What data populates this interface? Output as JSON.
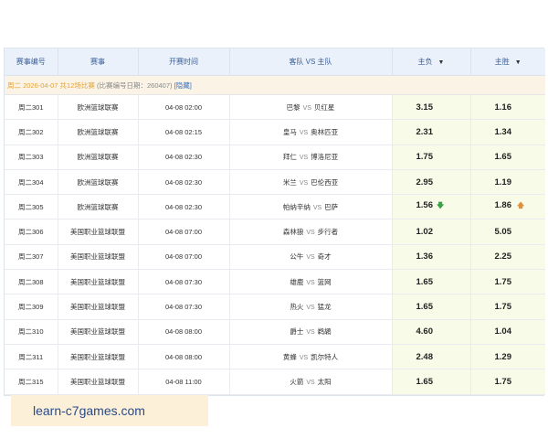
{
  "columns": {
    "match_no": "赛事编号",
    "league": "赛事",
    "start_time": "开赛时间",
    "teams": "客队 VS 主队",
    "away_win": "主负",
    "home_win": "主胜"
  },
  "group": {
    "date": "周二 2026-04-07",
    "count": "共12场比赛",
    "note": "(比赛编号日期：260407)",
    "link": "[隐藏]"
  },
  "vs_label": "VS",
  "rows": [
    {
      "no": "周二301",
      "league": "欧洲篮球联赛",
      "time": "04-08 02:00",
      "away": "巴黎",
      "home": "贝红星",
      "odd1": "3.15",
      "odd2": "1.16"
    },
    {
      "no": "周二302",
      "league": "欧洲篮球联赛",
      "time": "04-08 02:15",
      "away": "皇马",
      "home": "奥林匹亚",
      "odd1": "2.31",
      "odd2": "1.34"
    },
    {
      "no": "周二303",
      "league": "欧洲篮球联赛",
      "time": "04-08 02:30",
      "away": "拜仁",
      "home": "博洛尼亚",
      "odd1": "1.75",
      "odd2": "1.65"
    },
    {
      "no": "周二304",
      "league": "欧洲篮球联赛",
      "time": "04-08 02:30",
      "away": "米兰",
      "home": "巴伦西亚",
      "odd1": "2.95",
      "odd2": "1.19"
    },
    {
      "no": "周二305",
      "league": "欧洲篮球联赛",
      "time": "04-08 02:30",
      "away": "帕纳辛纳",
      "home": "巴萨",
      "odd1": "1.56",
      "odd2": "1.86",
      "odd1_trend": "down",
      "odd2_trend": "up"
    },
    {
      "no": "周二306",
      "league": "美国职业篮球联盟",
      "time": "04-08 07:00",
      "away": "森林狼",
      "home": "步行者",
      "odd1": "1.02",
      "odd2": "5.05"
    },
    {
      "no": "周二307",
      "league": "美国职业篮球联盟",
      "time": "04-08 07:00",
      "away": "公牛",
      "home": "奇才",
      "odd1": "1.36",
      "odd2": "2.25"
    },
    {
      "no": "周二308",
      "league": "美国职业篮球联盟",
      "time": "04-08 07:30",
      "away": "雄鹿",
      "home": "篮网",
      "odd1": "1.65",
      "odd2": "1.75"
    },
    {
      "no": "周二309",
      "league": "美国职业篮球联盟",
      "time": "04-08 07:30",
      "away": "热火",
      "home": "猛龙",
      "odd1": "1.65",
      "odd2": "1.75"
    },
    {
      "no": "周二310",
      "league": "美国职业篮球联盟",
      "time": "04-08 08:00",
      "away": "爵士",
      "home": "鹈鹕",
      "odd1": "4.60",
      "odd2": "1.04"
    },
    {
      "no": "周二311",
      "league": "美国职业篮球联盟",
      "time": "04-08 08:00",
      "away": "黄蜂",
      "home": "凯尔特人",
      "odd1": "2.48",
      "odd2": "1.29"
    },
    {
      "no": "周二315",
      "league": "美国职业篮球联盟",
      "time": "04-08 11:00",
      "away": "火箭",
      "home": "太阳",
      "odd1": "1.65",
      "odd2": "1.75"
    }
  ],
  "watermark": "learn-c7games.com",
  "icons": {
    "sort": "caret-down-icon",
    "up": "arrow-up-icon",
    "down": "arrow-down-icon"
  },
  "colors": {
    "header_bg": "#eaf1fb",
    "odds_bg": "#f8fbe8",
    "group_bg": "#fbf4e6",
    "watermark_bg": "#fcf0d9"
  }
}
